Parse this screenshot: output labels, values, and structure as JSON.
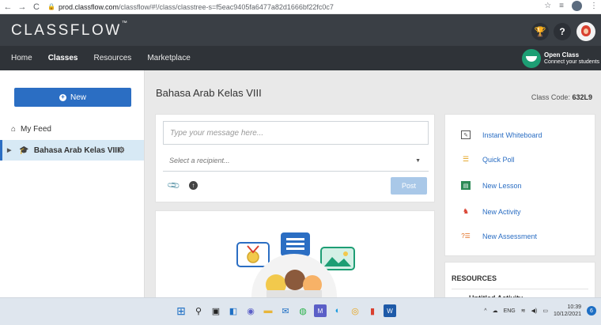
{
  "browser": {
    "url_host": "prod.classflow.com",
    "url_path": "/classflow/#!/class/classtree-s=f5eac9405fa6477a82d1666bf22fc0c7"
  },
  "header": {
    "logo": "CLASSFLOW",
    "logo_tm": "™"
  },
  "nav": {
    "items": [
      "Home",
      "Classes",
      "Resources",
      "Marketplace"
    ],
    "active": "Classes"
  },
  "open_class": {
    "title": "Open Class",
    "subtitle": "Connect your students"
  },
  "sidebar": {
    "new_label": "New",
    "feed_label": "My Feed",
    "class_label": "Bahasa Arab Kelas VIII"
  },
  "main": {
    "class_title": "Bahasa Arab Kelas VIII",
    "class_code_label": "Class Code:",
    "class_code": "632L9",
    "message_placeholder": "Type your message here...",
    "recipient_placeholder": "Select a recipient...",
    "post_label": "Post"
  },
  "tools": {
    "items": [
      "Instant Whiteboard",
      "Quick Poll",
      "New Lesson",
      "New Activity",
      "New Assessment"
    ]
  },
  "resources": {
    "heading": "RESOURCES",
    "first_item": "Untitled Activity"
  },
  "taskbar": {
    "lang": "ENG",
    "time": "10:39",
    "date": "10/12/2021",
    "notifications": "6"
  },
  "colors": {
    "header_bg": "#3a3f45",
    "subnav_bg": "#2f3338",
    "accent_blue": "#2b6ec3",
    "open_class_green": "#1d9e74",
    "selected_row": "#d7e9f5"
  }
}
